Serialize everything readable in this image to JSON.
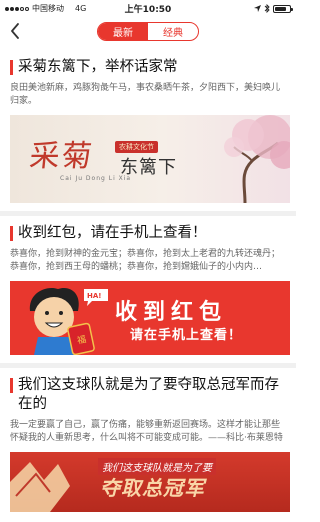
{
  "status_bar": {
    "carrier": "中国移动",
    "network": "4G",
    "time": "上午10:50"
  },
  "nav": {
    "tabs": [
      {
        "label": "最新",
        "active": true
      },
      {
        "label": "经典",
        "active": false
      }
    ]
  },
  "articles": [
    {
      "title": "采菊东篱下，举杯话家常",
      "desc": "良田美池新麻，鸡豚狗彘午马，事农桑晒午茶，夕阳西下，美妇唤儿归家。",
      "banner": {
        "big": "采菊",
        "stamp": "农耕文化节",
        "sub": "东篱下",
        "pinyin": "Cai Ju Dong Li Xia"
      }
    },
    {
      "title": "收到红包，请在手机上查看！",
      "desc": "恭喜你，抢到财神的金元宝；恭喜你，抢到太上老君的九转还魂丹；恭喜你，抢到西王母的蟠桃；恭喜你，抢到嫦娥仙子的小内内…",
      "banner": {
        "main": "收到红包",
        "sub": "请在手机上查看！",
        "badge": "HA!",
        "envelope": "福"
      }
    },
    {
      "title": "我们这支球队就是为了要夺取总冠军而存在的",
      "desc": "我一定要赢了自己，赢了伤痛，能够重新返回赛场。这样才能让那些怀疑我的人重新思考，什么叫将不可能变成可能。——科比·布莱恩特",
      "banner": {
        "top": "我们这支球队就是为了要",
        "main": "夺取总冠军"
      }
    }
  ],
  "colors": {
    "accent": "#e8372e",
    "divider": "#f0f0f0"
  },
  "icons": {
    "back": "chevron-left-icon",
    "wifi": "wifi-icon",
    "battery": "battery-icon"
  }
}
